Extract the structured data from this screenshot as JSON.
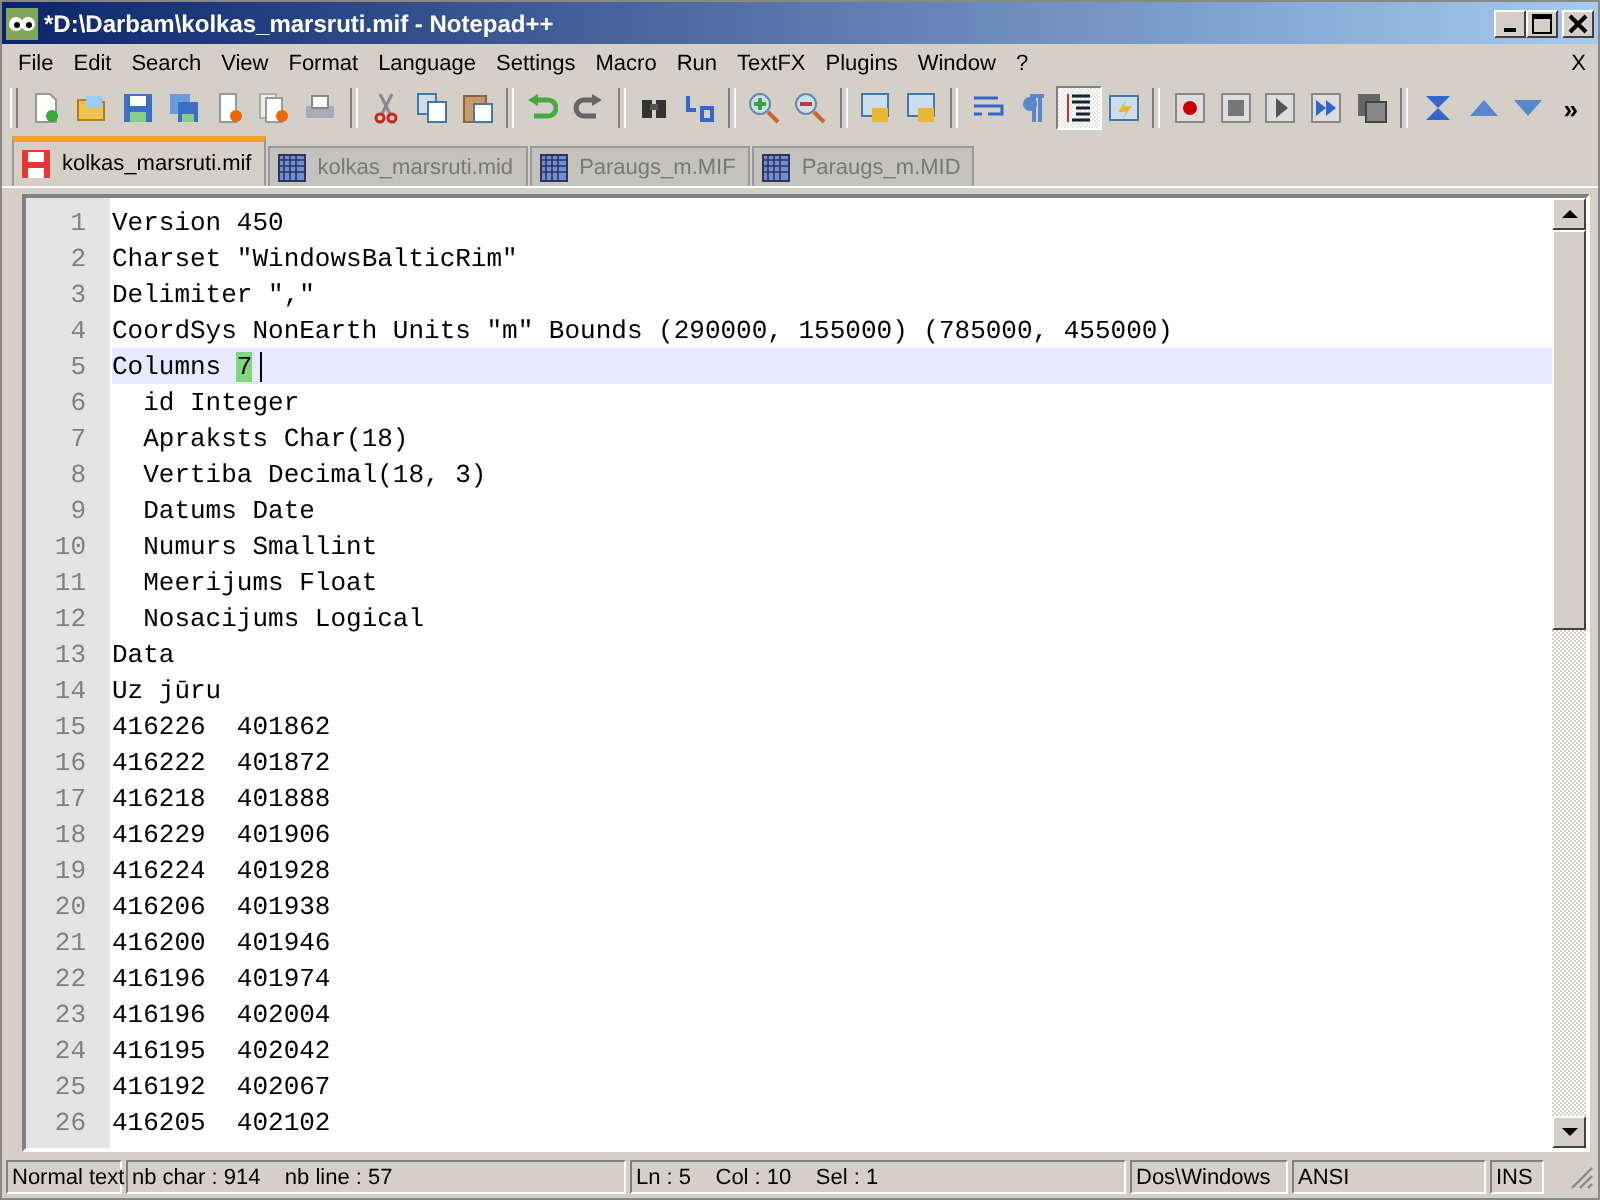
{
  "window": {
    "title": "*D:\\Darbam\\kolkas_marsruti.mif - Notepad++"
  },
  "menu": [
    "File",
    "Edit",
    "Search",
    "View",
    "Format",
    "Language",
    "Settings",
    "Macro",
    "Run",
    "TextFX",
    "Plugins",
    "Window",
    "?"
  ],
  "menu_close": "X",
  "toolbar": {
    "buttons": [
      {
        "pressed": false
      },
      {
        "pressed": false
      },
      {
        "pressed": false
      },
      {
        "pressed": false
      },
      {
        "pressed": false
      },
      {
        "pressed": false
      },
      {
        "pressed": false
      },
      {
        "pressed": false
      },
      {
        "pressed": false
      },
      {
        "pressed": false
      },
      {
        "pressed": false
      },
      {
        "pressed": false
      },
      {
        "pressed": false
      },
      {
        "pressed": false
      },
      {
        "pressed": false
      },
      {
        "pressed": false
      },
      {
        "pressed": false
      },
      {
        "pressed": false
      },
      {
        "pressed": false
      },
      {
        "pressed": false
      },
      {
        "pressed": true
      },
      {
        "pressed": false
      },
      {
        "pressed": false
      },
      {
        "pressed": false
      },
      {
        "pressed": false
      },
      {
        "pressed": false
      },
      {
        "pressed": false
      },
      {
        "pressed": false
      },
      {
        "pressed": false
      },
      {
        "pressed": false
      }
    ],
    "overflow": "»"
  },
  "tabs": [
    {
      "label": "kolkas_marsruti.mif",
      "selected": true,
      "modified": true
    },
    {
      "label": "kolkas_marsruti.mid",
      "selected": false,
      "modified": false
    },
    {
      "label": "Paraugs_m.MIF",
      "selected": false,
      "modified": false
    },
    {
      "label": "Paraugs_m.MID",
      "selected": false,
      "modified": false
    }
  ],
  "editor": {
    "lines": [
      {
        "number": "1",
        "text": "Version 450"
      },
      {
        "number": "2",
        "text": "Charset \"WindowsBalticRim\""
      },
      {
        "number": "3",
        "text": "Delimiter \",\""
      },
      {
        "number": "4",
        "text": "CoordSys NonEarth Units \"m\" Bounds (290000, 155000) (785000, 455000)"
      },
      {
        "number": "5",
        "text": "Columns ",
        "match": "7",
        "current": true
      },
      {
        "number": "6",
        "text": "  id Integer"
      },
      {
        "number": "7",
        "text": "  Apraksts Char(18)"
      },
      {
        "number": "8",
        "text": "  Vertiba Decimal(18, 3)"
      },
      {
        "number": "9",
        "text": "  Datums Date"
      },
      {
        "number": "10",
        "text": "  Numurs Smallint"
      },
      {
        "number": "11",
        "text": "  Meerijums Float"
      },
      {
        "number": "12",
        "text": "  Nosacijums Logical"
      },
      {
        "number": "13",
        "text": "Data"
      },
      {
        "number": "14",
        "text": "Uz jūru"
      },
      {
        "number": "15",
        "text": "416226  401862"
      },
      {
        "number": "16",
        "text": "416222  401872"
      },
      {
        "number": "17",
        "text": "416218  401888"
      },
      {
        "number": "18",
        "text": "416229  401906"
      },
      {
        "number": "19",
        "text": "416224  401928"
      },
      {
        "number": "20",
        "text": "416206  401938"
      },
      {
        "number": "21",
        "text": "416200  401946"
      },
      {
        "number": "22",
        "text": "416196  401974"
      },
      {
        "number": "23",
        "text": "416196  402004"
      },
      {
        "number": "24",
        "text": "416195  402042"
      },
      {
        "number": "25",
        "text": "416192  402067"
      },
      {
        "number": "26",
        "text": "416205  402102"
      }
    ]
  },
  "status_bar": [
    "Normal text",
    "nb char : 914    nb line : 57",
    "Ln : 5    Col : 10    Sel : 1",
    "Dos\\Windows",
    "ANSI",
    "INS"
  ]
}
